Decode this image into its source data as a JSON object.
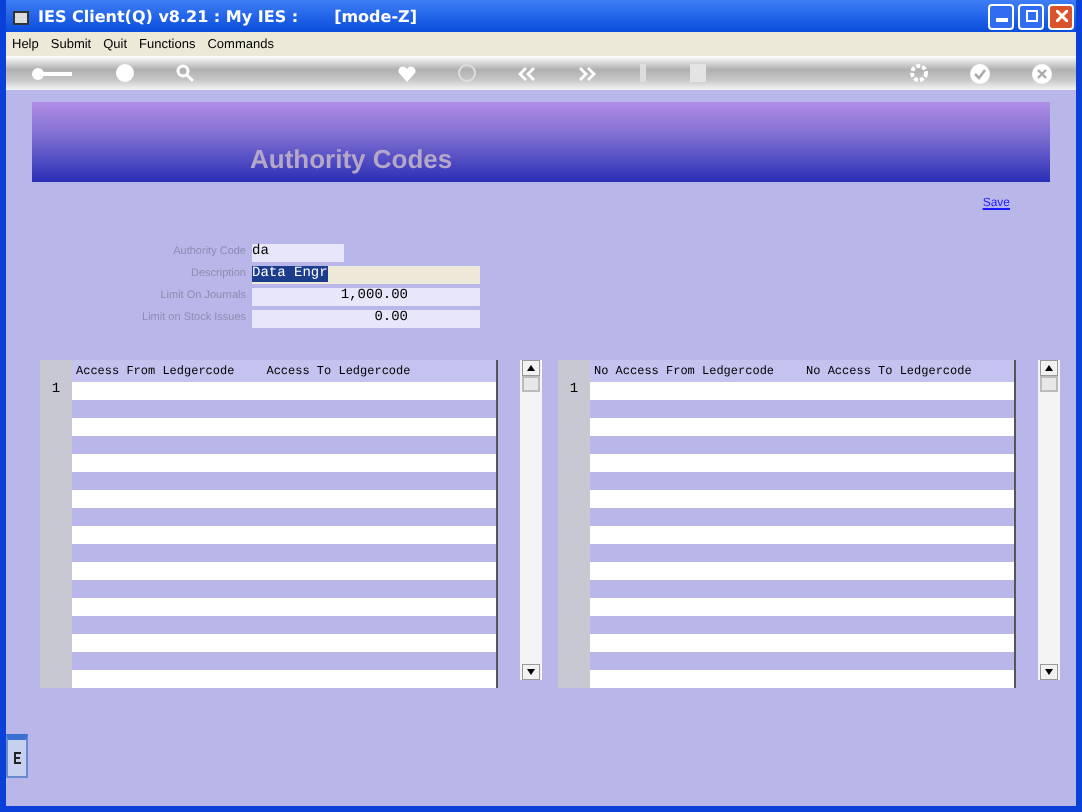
{
  "window": {
    "title": "IES Client(Q) v8.21 : My IES :",
    "mode": "[mode-Z]"
  },
  "menu": [
    "Help",
    "Submit",
    "Quit",
    "Functions",
    "Commands"
  ],
  "header": {
    "title": "Authority Codes"
  },
  "save_link": "Save",
  "form": [
    {
      "label": "Authority Code",
      "value": "da",
      "kind": "short",
      "selected": false
    },
    {
      "label": "Description",
      "value": "Data Engr",
      "kind": "wide",
      "selected": true
    },
    {
      "label": "Limit On Journals",
      "value": "1,000.00",
      "kind": "number",
      "selected": false
    },
    {
      "label": "Limit on Stock Issues",
      "value": "0.00",
      "kind": "number",
      "selected": false
    }
  ],
  "grids": [
    {
      "columns": [
        "Access From Ledgercode",
        "Access  To  Ledgercode"
      ],
      "row_numbers": [
        "1"
      ]
    },
    {
      "columns": [
        "No Access From Ledgercode",
        "No Access  To  Ledgercode"
      ],
      "row_numbers": [
        "1"
      ]
    }
  ]
}
